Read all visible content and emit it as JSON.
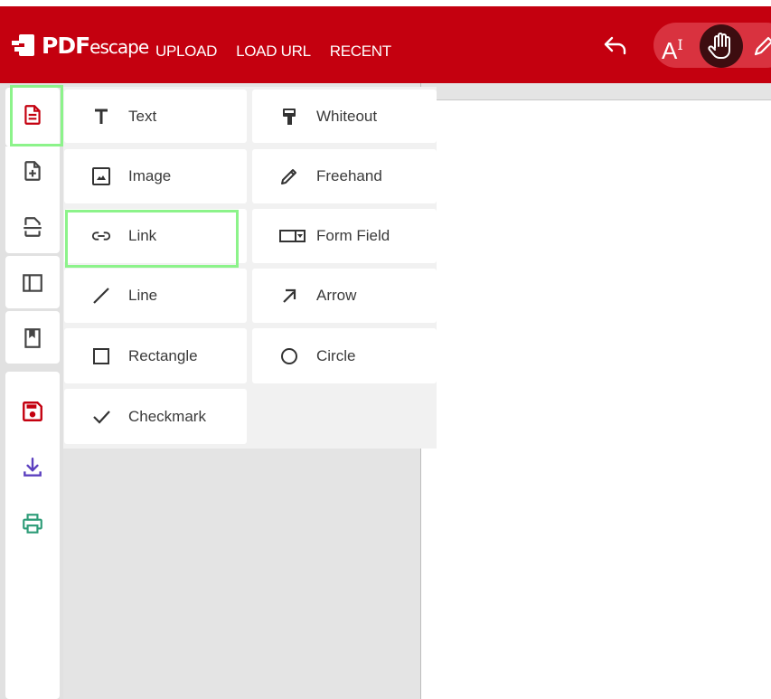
{
  "app": {
    "logo_pdf": "PDF",
    "logo_escape": "escape",
    "brand_color": "#c4000f",
    "highlight_color": "#8cf38a"
  },
  "header": {
    "nav": [
      {
        "label": "UPLOAD"
      },
      {
        "label": "LOAD URL"
      },
      {
        "label": "RECENT"
      }
    ],
    "undo_icon": "undo-icon",
    "text_mode_label": "A",
    "text_mode_cursor": "I",
    "hand_icon": "hand-icon",
    "pencil_icon": "pencil-icon"
  },
  "sidebar": {
    "items": [
      {
        "icon": "document-icon",
        "active": true
      },
      {
        "icon": "add-page-icon"
      },
      {
        "icon": "page-break-icon"
      },
      {
        "icon": "panel-toggle-icon"
      },
      {
        "icon": "bookmark-icon"
      },
      {
        "icon": "save-icon"
      },
      {
        "icon": "download-icon"
      },
      {
        "icon": "print-icon"
      }
    ]
  },
  "tools": [
    {
      "label": "Text",
      "icon": "text-icon"
    },
    {
      "label": "Whiteout",
      "icon": "whiteout-icon"
    },
    {
      "label": "Image",
      "icon": "image-icon"
    },
    {
      "label": "Freehand",
      "icon": "freehand-icon"
    },
    {
      "label": "Link",
      "icon": "link-icon",
      "highlighted": true
    },
    {
      "label": "Form Field",
      "icon": "form-field-icon"
    },
    {
      "label": "Line",
      "icon": "line-icon"
    },
    {
      "label": "Arrow",
      "icon": "arrow-icon"
    },
    {
      "label": "Rectangle",
      "icon": "rectangle-icon"
    },
    {
      "label": "Circle",
      "icon": "circle-icon"
    },
    {
      "label": "Checkmark",
      "icon": "checkmark-icon"
    }
  ]
}
